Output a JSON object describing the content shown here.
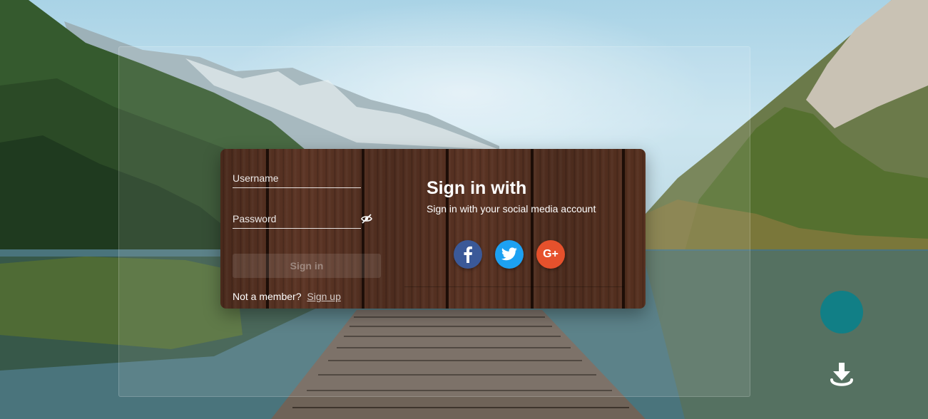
{
  "login": {
    "username_placeholder": "Username",
    "password_placeholder": "Password",
    "password_toggle_icon": "eye-off-icon",
    "signin_label": "Sign in",
    "member_prompt": "Not a member?",
    "signup_label": "Sign up"
  },
  "social": {
    "title": "Sign in with",
    "subtitle": "Sign in with your social media account",
    "buttons": [
      {
        "name": "facebook",
        "icon": "facebook-icon",
        "color": "#3b5998"
      },
      {
        "name": "twitter",
        "icon": "twitter-icon",
        "color": "#1da1f2"
      },
      {
        "name": "google-plus",
        "icon": "google-plus-icon",
        "label": "G+",
        "color": "#e6512c"
      }
    ]
  },
  "fab": {
    "color": "#117f86"
  },
  "download": {
    "icon": "download-icon"
  }
}
